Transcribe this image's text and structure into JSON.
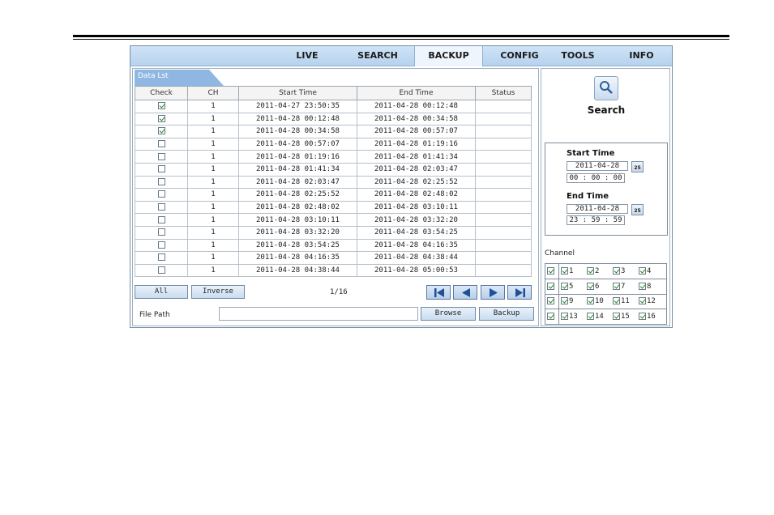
{
  "tabs": [
    {
      "label": "LIVE",
      "active": false
    },
    {
      "label": "SEARCH",
      "active": false
    },
    {
      "label": "BACKUP",
      "active": true
    },
    {
      "label": "CONFIG",
      "active": false
    },
    {
      "label": "TOOLS",
      "active": false
    },
    {
      "label": "INFO",
      "active": false
    }
  ],
  "data_list": {
    "tab_label": "Data Lst",
    "columns": [
      "Check",
      "CH",
      "Start Time",
      "End Time",
      "Status"
    ],
    "rows": [
      {
        "checked": true,
        "ch": "1",
        "start": "2011-04-27 23:50:35",
        "end": "2011-04-28 00:12:48",
        "status": ""
      },
      {
        "checked": true,
        "ch": "1",
        "start": "2011-04-28 00:12:48",
        "end": "2011-04-28 00:34:58",
        "status": ""
      },
      {
        "checked": true,
        "ch": "1",
        "start": "2011-04-28 00:34:58",
        "end": "2011-04-28 00:57:07",
        "status": ""
      },
      {
        "checked": false,
        "ch": "1",
        "start": "2011-04-28 00:57:07",
        "end": "2011-04-28 01:19:16",
        "status": ""
      },
      {
        "checked": false,
        "ch": "1",
        "start": "2011-04-28 01:19:16",
        "end": "2011-04-28 01:41:34",
        "status": ""
      },
      {
        "checked": false,
        "ch": "1",
        "start": "2011-04-28 01:41:34",
        "end": "2011-04-28 02:03:47",
        "status": ""
      },
      {
        "checked": false,
        "ch": "1",
        "start": "2011-04-28 02:03:47",
        "end": "2011-04-28 02:25:52",
        "status": ""
      },
      {
        "checked": false,
        "ch": "1",
        "start": "2011-04-28 02:25:52",
        "end": "2011-04-28 02:48:02",
        "status": ""
      },
      {
        "checked": false,
        "ch": "1",
        "start": "2011-04-28 02:48:02",
        "end": "2011-04-28 03:10:11",
        "status": ""
      },
      {
        "checked": false,
        "ch": "1",
        "start": "2011-04-28 03:10:11",
        "end": "2011-04-28 03:32:20",
        "status": ""
      },
      {
        "checked": false,
        "ch": "1",
        "start": "2011-04-28 03:32:20",
        "end": "2011-04-28 03:54:25",
        "status": ""
      },
      {
        "checked": false,
        "ch": "1",
        "start": "2011-04-28 03:54:25",
        "end": "2011-04-28 04:16:35",
        "status": ""
      },
      {
        "checked": false,
        "ch": "1",
        "start": "2011-04-28 04:16:35",
        "end": "2011-04-28 04:38:44",
        "status": ""
      },
      {
        "checked": false,
        "ch": "1",
        "start": "2011-04-28 04:38:44",
        "end": "2011-04-28 05:00:53",
        "status": ""
      }
    ]
  },
  "buttons": {
    "all": "All",
    "inverse": "Inverse",
    "browse": "Browse",
    "backup": "Backup"
  },
  "pager": {
    "text": "1/16",
    "icons": [
      "first-page-icon",
      "prev-page-icon",
      "next-page-icon",
      "last-page-icon"
    ]
  },
  "file_path": {
    "label": "File Path",
    "value": ""
  },
  "search": {
    "icon": "magnifier-icon",
    "label": "Search"
  },
  "time": {
    "start_label": "Start Time",
    "start_date": "2011-04-28",
    "start_time": "00 : 00 : 00",
    "end_label": "End Time",
    "end_date": "2011-04-28",
    "end_time": "23 : 59 : 59",
    "calendar_icon_text": "25"
  },
  "channel": {
    "label": "Channel",
    "rows": [
      {
        "all_checked": true,
        "channels": [
          {
            "n": "1",
            "checked": true
          },
          {
            "n": "2",
            "checked": true
          },
          {
            "n": "3",
            "checked": true
          },
          {
            "n": "4",
            "checked": true
          }
        ]
      },
      {
        "all_checked": true,
        "channels": [
          {
            "n": "5",
            "checked": true
          },
          {
            "n": "6",
            "checked": true
          },
          {
            "n": "7",
            "checked": true
          },
          {
            "n": "8",
            "checked": true
          }
        ]
      },
      {
        "all_checked": true,
        "channels": [
          {
            "n": "9",
            "checked": true
          },
          {
            "n": "10",
            "checked": true
          },
          {
            "n": "11",
            "checked": true
          },
          {
            "n": "12",
            "checked": true
          }
        ]
      },
      {
        "all_checked": true,
        "channels": [
          {
            "n": "13",
            "checked": true
          },
          {
            "n": "14",
            "checked": true
          },
          {
            "n": "15",
            "checked": true
          },
          {
            "n": "16",
            "checked": true
          }
        ]
      }
    ]
  },
  "colors": {
    "tab_bar": "#b6d2ee",
    "data_tab": "#8fb7e2",
    "check_green": "#1f8a1f"
  }
}
